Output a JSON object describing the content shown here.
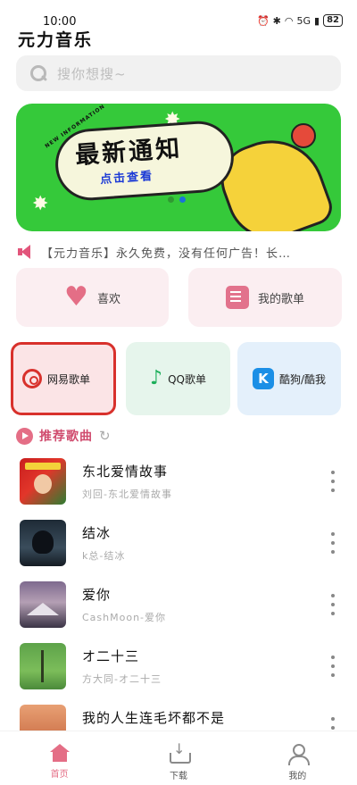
{
  "status_bar": {
    "time": "10:00",
    "network": "5G",
    "battery": "82"
  },
  "app": {
    "title": "元力音乐"
  },
  "search": {
    "placeholder": "搜你想搜~"
  },
  "banner": {
    "tag": "NEW INFORMATION",
    "title": "最新通知",
    "subtitle": "点击查看",
    "colors": {
      "background": "#35c93a",
      "hand": "#f5d23a",
      "accent": "#e54a3a"
    }
  },
  "notice": {
    "text": "【元力音乐】永久免费，没有任何广告！长…"
  },
  "favorites": {
    "like_label": "喜欢",
    "my_playlist_label": "我的歌单"
  },
  "platforms": {
    "netease_label": "网易歌单",
    "qq_label": "QQ歌单",
    "kugou_label": "酷狗/酷我",
    "kugou_icon_text": "K"
  },
  "recommended": {
    "title": "推荐歌曲"
  },
  "songs": [
    {
      "title": "东北爱情故事",
      "subtitle": "刘回-东北爱情故事"
    },
    {
      "title": "结冰",
      "subtitle": "k总-结冰"
    },
    {
      "title": "爱你",
      "subtitle": "CashMoon-爱你"
    },
    {
      "title": "オ二十三",
      "subtitle": "方大同-オ二十三"
    },
    {
      "title": "我的人生连毛坏都不是",
      "subtitle": ""
    }
  ],
  "bottom_nav": [
    {
      "label": "首页",
      "icon": "home-icon",
      "active": true
    },
    {
      "label": "下载",
      "icon": "download-icon",
      "active": false
    },
    {
      "label": "我的",
      "icon": "user-icon",
      "active": false
    }
  ],
  "theme": {
    "accent": "#e46e86",
    "netease_red": "#d8312c",
    "qq_green": "#1cae5a",
    "kugou_blue": "#1b8fe6"
  }
}
